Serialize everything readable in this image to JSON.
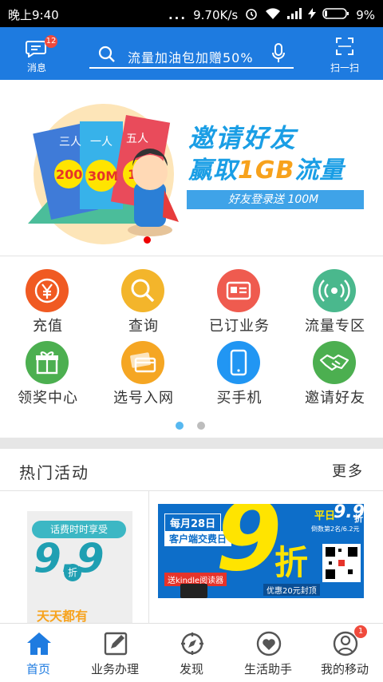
{
  "status_bar": {
    "time": "晚上9:40",
    "speed": "9.70K/s",
    "battery": "9%",
    "dots": "..."
  },
  "header": {
    "messages_label": "消息",
    "messages_badge": "12",
    "search_placeholder": "流量加油包加赠50%",
    "scan_label": "扫一扫"
  },
  "banner": {
    "headline": "邀请好友",
    "subline_prefix": "赢取",
    "subline_highlight": "1GB",
    "subline_suffix": "流量",
    "pill_text": "好友登录送 100M",
    "card_labels": [
      "三人",
      "一人",
      "五人"
    ],
    "card_values": [
      "200",
      "30M",
      "1G"
    ]
  },
  "services": [
    {
      "label": "充值",
      "icon": "yuan-icon",
      "color": "#f05a22"
    },
    {
      "label": "查询",
      "icon": "magnifier-icon",
      "color": "#f3b52b"
    },
    {
      "label": "已订业务",
      "icon": "id-card-icon",
      "color": "#ef5b4f"
    },
    {
      "label": "流量专区",
      "icon": "signal-icon",
      "color": "#4ab88d"
    },
    {
      "label": "领奖中心",
      "icon": "gift-icon",
      "color": "#4caf50"
    },
    {
      "label": "选号入网",
      "icon": "sim-card-icon",
      "color": "#f5a623"
    },
    {
      "label": "买手机",
      "icon": "phone-icon",
      "color": "#2196f3"
    },
    {
      "label": "邀请好友",
      "icon": "handshake-icon",
      "color": "#4caf50"
    }
  ],
  "pager": {
    "pages": 2,
    "active": 0,
    "active_color": "#57b8f0",
    "inactive_color": "#bdbdbd"
  },
  "hot_section": {
    "title": "热门活动",
    "more": "更多"
  },
  "activities": {
    "a1": {
      "line1": "话费时时享受",
      "big": "9.9",
      "zhe": "折",
      "line2": "天天都有"
    },
    "a2": {
      "tag1": "每月28日",
      "tag2": "客户端交费日",
      "big": "9",
      "zhe": "折",
      "ping": "平日",
      "ping_val": "9.9",
      "ping_zhe": "折",
      "kindle": "送kindle阅读器",
      "note": "优惠20元封顶",
      "sub": "倒数第2名/6.2元"
    }
  },
  "tabs": [
    {
      "label": "首页",
      "icon": "home-icon",
      "active": true
    },
    {
      "label": "业务办理",
      "icon": "edit-icon"
    },
    {
      "label": "发现",
      "icon": "compass-icon"
    },
    {
      "label": "生活助手",
      "icon": "heart-icon"
    },
    {
      "label": "我的移动",
      "icon": "user-icon",
      "badge": "1"
    }
  ],
  "colors": {
    "brand_blue": "#1e7be0",
    "badge_red": "#f04a3c"
  }
}
